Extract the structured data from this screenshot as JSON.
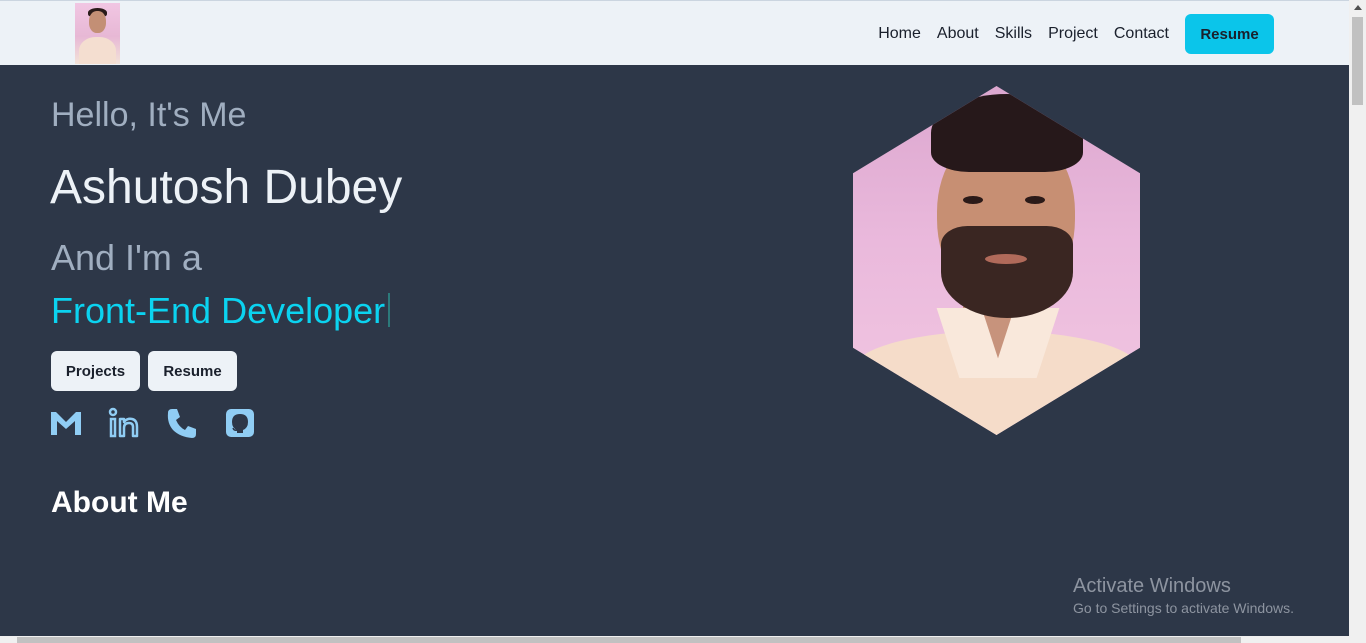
{
  "nav": {
    "logo_icon": "profile-photo-thumbnail",
    "links": [
      "Home",
      "About",
      "Skills",
      "Project",
      "Contact"
    ],
    "resume_label": "Resume"
  },
  "hero": {
    "greeting": "Hello, It's Me",
    "name": "Ashutosh Dubey",
    "role_prefix": "And I'm a",
    "role": "Front-End Developer",
    "buttons": {
      "projects": "Projects",
      "resume": "Resume"
    },
    "social_icons": [
      "gmail-icon",
      "linkedin-icon",
      "phone-icon",
      "github-icon"
    ],
    "accent_color": "#0bd3f0"
  },
  "about": {
    "heading": "About Me"
  },
  "watermark": {
    "title": "Activate Windows",
    "subtitle": "Go to Settings to activate Windows."
  },
  "colors": {
    "page_bg": "#2d3748",
    "nav_bg": "#edf2f7",
    "resume_button": "#0bc5ea",
    "icon": "#90cdf4"
  }
}
